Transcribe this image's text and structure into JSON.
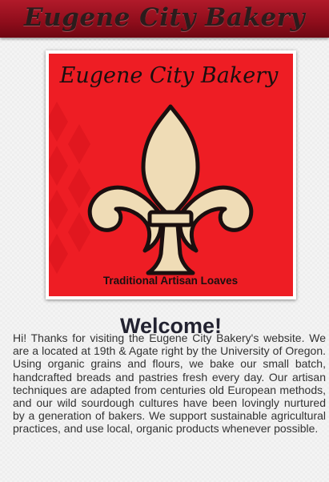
{
  "header": {
    "title": "Eugene City Bakery"
  },
  "logo": {
    "top_text": "Eugene City Bakery",
    "bottom_text": "Traditional Artisan Loaves",
    "background_color": "#ee1d24",
    "frame_color": "#ffffff",
    "emblem_color": "#efdcb6",
    "outline_color": "#1a0f0f",
    "icon": "fleur-de-lis-icon"
  },
  "main": {
    "heading": "Welcome!",
    "intro": "Hi! Thanks for visiting the Eugene City Bakery's website. We are a located at 19th & Agate right by the University of Oregon. Using organic grains and flours, we bake our small batch, handcrafted breads and pastries fresh every day. Our artisan techniques are adapted from centuries old European methods, and our wild sourdough cultures have been lovingly nurtured by a generation of bakers. We support sustainable agricultural practices, and use local, organic products whenever possible."
  },
  "colors": {
    "header_bar": "#9a1020",
    "header_text": "#2b1c1c",
    "heading_text": "#222230",
    "body_text": "#333333"
  }
}
